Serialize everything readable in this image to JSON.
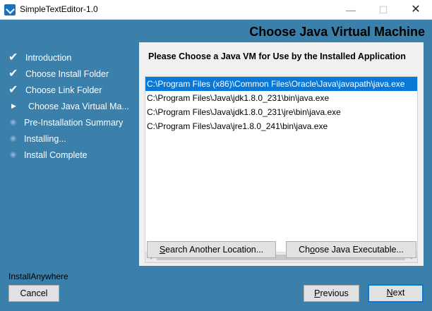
{
  "window": {
    "title": "SimpleTextEditor-1.0",
    "minimize": "—",
    "maximize": "☐",
    "close": "✕"
  },
  "header": {
    "title": "Choose Java Virtual Machine"
  },
  "steps": [
    {
      "label": "Introduction",
      "state": "done",
      "mark": "✔"
    },
    {
      "label": "Choose Install Folder",
      "state": "done",
      "mark": "✔"
    },
    {
      "label": "Choose Link Folder",
      "state": "done",
      "mark": "✔"
    },
    {
      "label": "Choose Java Virtual Ma...",
      "state": "current",
      "mark": "▶"
    },
    {
      "label": "Pre-Installation Summary",
      "state": "pending",
      "mark": ""
    },
    {
      "label": "Installing...",
      "state": "pending",
      "mark": ""
    },
    {
      "label": "Install Complete",
      "state": "pending",
      "mark": ""
    }
  ],
  "panel": {
    "question": "Please Choose a Java VM for Use by the Installed Application",
    "jvm_list": [
      "C:\\Program Files (x86)\\Common Files\\Oracle\\Java\\javapath\\java.exe",
      "C:\\Program Files\\Java\\jdk1.8.0_231\\bin\\java.exe",
      "C:\\Program Files\\Java\\jdk1.8.0_231\\jre\\bin\\java.exe",
      "C:\\Program Files\\Java\\jre1.8.0_241\\bin\\java.exe"
    ],
    "selected_index": 0,
    "search_button": {
      "mnemonic": "S",
      "rest": "earch Another Location..."
    },
    "choose_button": {
      "mnemonic": "",
      "prefix": "Ch",
      "mn": "o",
      "rest": "ose Java Executable..."
    }
  },
  "footer": {
    "vendor": "InstallAnywhere",
    "cancel": "Cancel",
    "previous": {
      "mn": "P",
      "rest": "revious"
    },
    "next": {
      "mn": "N",
      "rest": "ext"
    }
  },
  "colors": {
    "background": "#3b7fab",
    "selection": "#0a78d7"
  }
}
